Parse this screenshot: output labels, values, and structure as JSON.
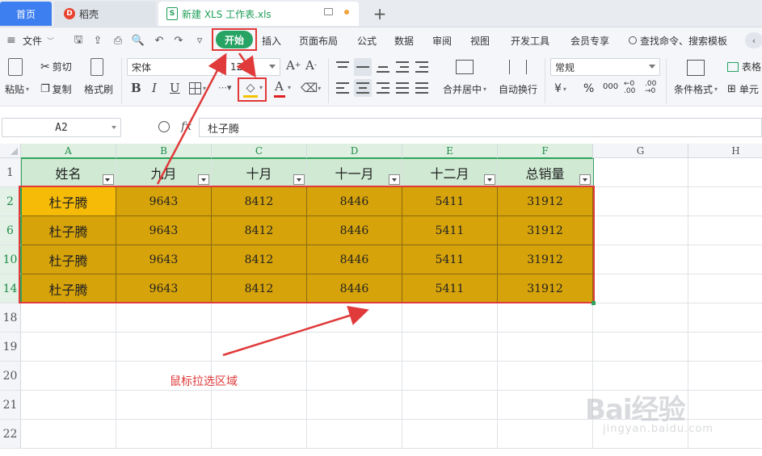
{
  "tabs": {
    "home": "首页",
    "daoke": "稻壳",
    "sheet": "新建 XLS 工作表.xls"
  },
  "menu": {
    "file": "文件",
    "items": [
      "开始",
      "插入",
      "页面布局",
      "公式",
      "数据",
      "审阅",
      "视图",
      "开发工具",
      "会员专享"
    ],
    "search": "查找命令、搜索模板"
  },
  "ribbon": {
    "paste": "粘贴",
    "cut": "剪切",
    "copy": "复制",
    "format_painter": "格式刷",
    "font_name": "宋体",
    "font_size": "12",
    "merge_center": "合并居中",
    "wrap_text": "自动换行",
    "number_format": "常规",
    "conditional_format": "条件格式",
    "table_style": "表格",
    "cell": "单元",
    "font_color": "#e02020",
    "fill_color": "#f5c400"
  },
  "formula": {
    "cell_ref": "A2",
    "fx": "fx",
    "value": "杜子腾"
  },
  "grid": {
    "columns": [
      "A",
      "B",
      "C",
      "D",
      "E",
      "F",
      "G",
      "H"
    ],
    "header_row_label": "1",
    "headers": [
      "姓名",
      "九月",
      "十月",
      "十一月",
      "十二月",
      "总销量"
    ],
    "rows": [
      {
        "row": "2",
        "cells": [
          "杜子腾",
          "9643",
          "8412",
          "8446",
          "5411",
          "31912"
        ]
      },
      {
        "row": "6",
        "cells": [
          "杜子腾",
          "9643",
          "8412",
          "8446",
          "5411",
          "31912"
        ]
      },
      {
        "row": "10",
        "cells": [
          "杜子腾",
          "9643",
          "8412",
          "8446",
          "5411",
          "31912"
        ]
      },
      {
        "row": "14",
        "cells": [
          "杜子腾",
          "9643",
          "8412",
          "8446",
          "5411",
          "31912"
        ]
      }
    ],
    "empty_rows": [
      "18",
      "19",
      "20",
      "21",
      "22"
    ]
  },
  "annotation": "鼠标拉选区域",
  "watermark": {
    "logo": "Bai经验",
    "url": "jingyan.baidu.com"
  }
}
